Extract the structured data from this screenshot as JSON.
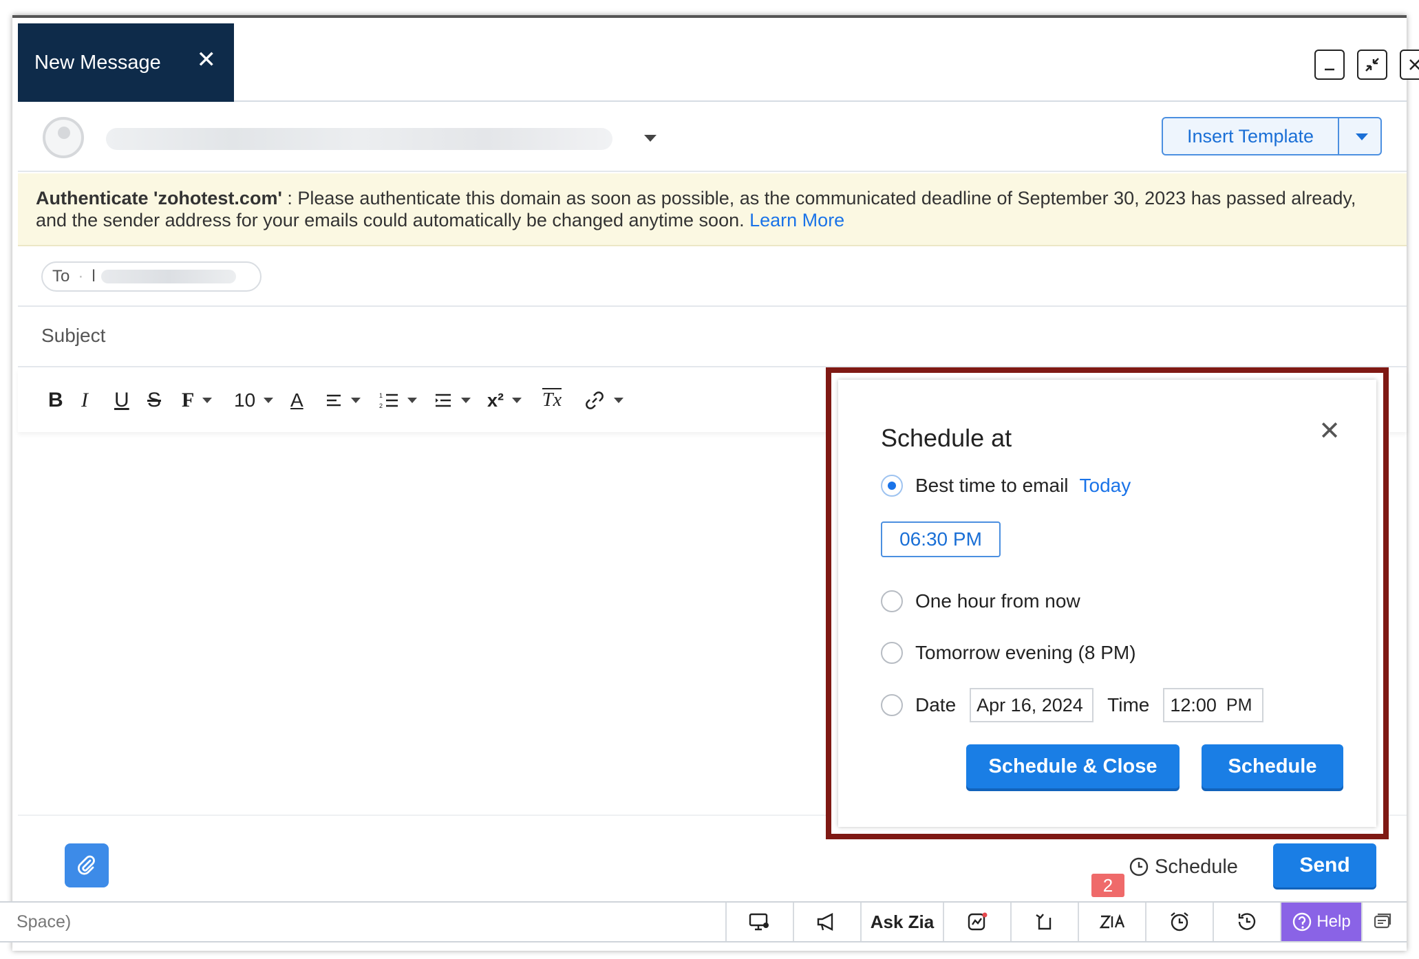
{
  "compose": {
    "tab_title": "New Message",
    "close_glyph": "✕"
  },
  "from": {
    "insert_template_label": "Insert Template"
  },
  "banner": {
    "domain_label": "Authenticate 'zohotest.com'",
    "message": " : Please authenticate this domain as soon as possible, as the communicated deadline of September 30, 2023 has passed already, and the sender address for your emails could automatically be changed anytime soon.",
    "link_label": "Learn More"
  },
  "to": {
    "label": "To",
    "separator": "·",
    "first_char": "l"
  },
  "subject": {
    "placeholder": "Subject"
  },
  "toolbar": {
    "bold": "B",
    "italic": "I",
    "underline": "U",
    "strike": "S",
    "font": "F",
    "font_size": "10",
    "text_color": "A",
    "superscript": "x²",
    "clear_format": "Tx"
  },
  "actions": {
    "schedule_label": "Schedule",
    "send_label": "Send"
  },
  "schedule_popup": {
    "title": "Schedule at",
    "close_glyph": "✕",
    "option_best": "Best time to email",
    "best_day": "Today",
    "best_time": "06:30 PM",
    "option_hour": "One hour from now",
    "option_tomorrow": "Tomorrow evening (8 PM)",
    "option_date": "Date",
    "date_value": "Apr 16, 2024",
    "time_label": "Time",
    "time_value": "12:00",
    "time_ampm": "PM",
    "schedule_close_label": "Schedule & Close",
    "schedule_label": "Schedule",
    "selected_option": "best"
  },
  "statusbar": {
    "left_text": "Space)",
    "ask_zia": "Ask Zia",
    "badge_count": "2",
    "help": "Help"
  },
  "colors": {
    "compose_tab_bg": "#0e2b4a",
    "accent_blue": "#1a7ee5",
    "popup_highlight_border": "#7f1914",
    "banner_bg": "#fbf8e2",
    "help_purple": "#8a63e6",
    "badge_red": "#ef6a6a"
  },
  "icons": {
    "minimize": "minimize-icon",
    "restore": "restore-icon",
    "close": "close-icon",
    "attach": "paperclip-icon",
    "clock": "clock-icon"
  }
}
